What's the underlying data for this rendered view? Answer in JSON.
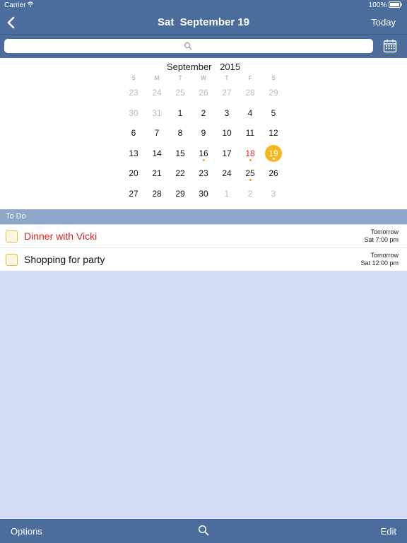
{
  "status": {
    "carrier": "Carrier",
    "battery": "100%"
  },
  "nav": {
    "title": "Sat  September 19",
    "today": "Today"
  },
  "search": {
    "placeholder": ""
  },
  "calendar": {
    "month": "September",
    "year": "2015",
    "weekdays": [
      "S",
      "M",
      "T",
      "W",
      "T",
      "F",
      "S"
    ],
    "weeks": [
      [
        "23",
        "24",
        "25",
        "26",
        "27",
        "28",
        "29"
      ],
      [
        "30",
        "31",
        "1",
        "2",
        "3",
        "4",
        "5"
      ],
      [
        "6",
        "7",
        "8",
        "9",
        "10",
        "11",
        "12"
      ],
      [
        "13",
        "14",
        "15",
        "16",
        "17",
        "18",
        "19"
      ],
      [
        "20",
        "21",
        "22",
        "23",
        "24",
        "25",
        "26"
      ],
      [
        "27",
        "28",
        "29",
        "30",
        "1",
        "2",
        "3"
      ]
    ],
    "selected": "19",
    "today": "18",
    "event_days": [
      "16",
      "18",
      "19",
      "25"
    ]
  },
  "section": {
    "title": "To Do"
  },
  "todos": [
    {
      "label": "Dinner with Vicki",
      "when": "Tomorrow",
      "time": "Sat 7:00 pm",
      "color": "#e02020"
    },
    {
      "label": "Shopping for party",
      "when": "Tomorrow",
      "time": "Sat 12:00 pm",
      "color": "#111111"
    }
  ],
  "toolbar": {
    "options": "Options",
    "edit": "Edit"
  },
  "colors": {
    "bar": "#4a6d9c",
    "accent": "#f5b81c",
    "background": "#d4ddf5"
  }
}
